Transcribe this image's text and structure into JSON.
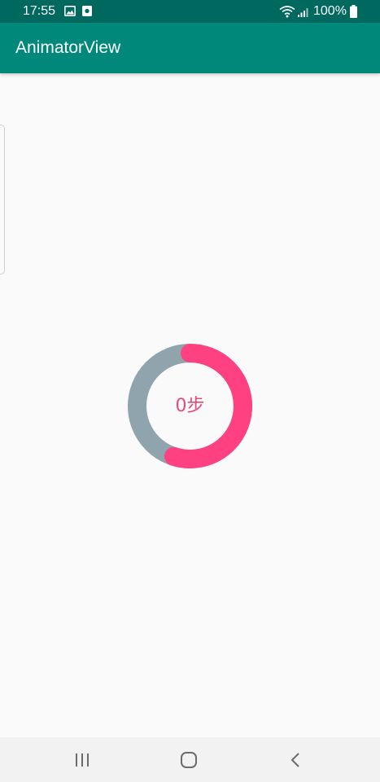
{
  "status_bar": {
    "time": "17:55",
    "battery": "100%",
    "icons": [
      "gallery-icon",
      "sim-icon",
      "wifi-icon",
      "signal-icon",
      "battery-icon"
    ],
    "background": "#00695f"
  },
  "app_bar": {
    "title": "AnimatorView",
    "background": "#00897b"
  },
  "ring": {
    "label": "0步",
    "progress": 0.55,
    "track_color": "#90a4ae",
    "progress_color": "#ff4081"
  },
  "nav_bar": {
    "icons": [
      "recents-icon",
      "home-icon",
      "back-icon"
    ]
  }
}
